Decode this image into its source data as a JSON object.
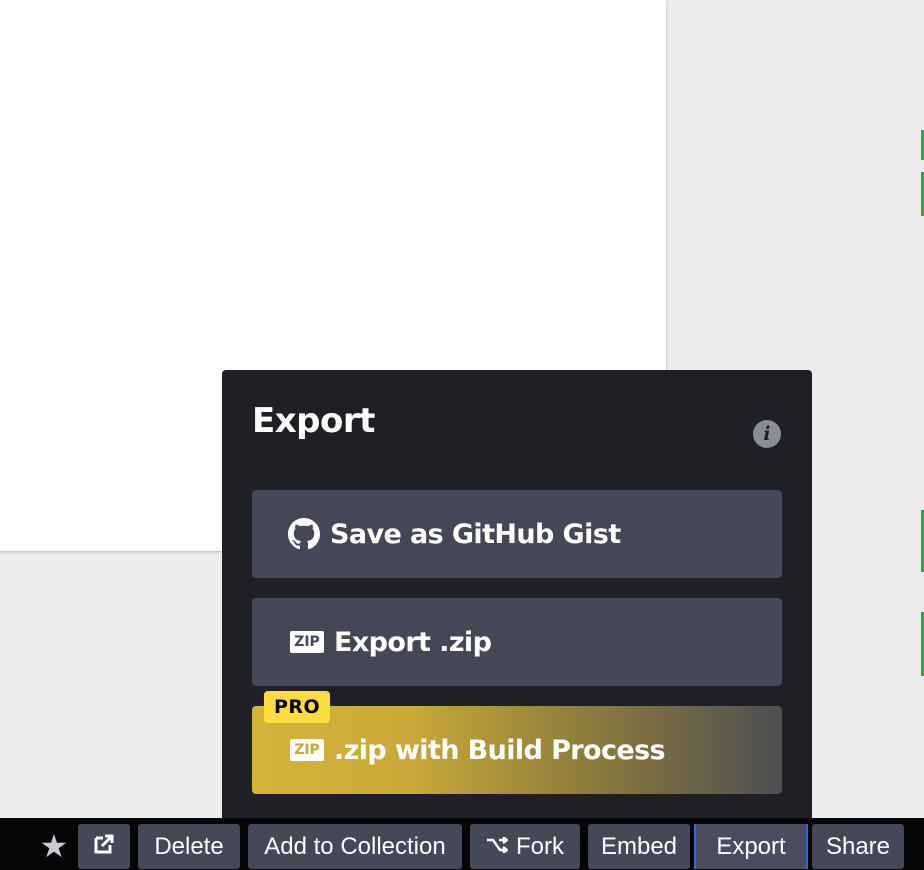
{
  "popup": {
    "title": "Export",
    "info_icon": "info-icon",
    "options": [
      {
        "label": "Save as GitHub Gist",
        "icon": "github-icon"
      },
      {
        "label": "Export .zip",
        "icon": "zip-icon",
        "icon_text": "ZIP"
      },
      {
        "label": ".zip with Build Process",
        "icon": "zip-icon",
        "icon_text": "ZIP",
        "badge": "PRO"
      }
    ],
    "colors": {
      "background": "#1f2026",
      "option_background": "#454756",
      "pro_badge": "#ffdd40",
      "pro_gradient_start": "#d6b43a"
    }
  },
  "toolbar": {
    "star_icon": "star-icon",
    "external_icon": "external-link-icon",
    "delete_label": "Delete",
    "collection_label": "Add to Collection",
    "fork_icon": "fork-icon",
    "fork_label": "Fork",
    "embed_label": "Embed",
    "export_label": "Export",
    "share_label": "Share",
    "colors": {
      "background": "#050505",
      "button": "#444857",
      "active_border": "#2f68d8"
    }
  }
}
